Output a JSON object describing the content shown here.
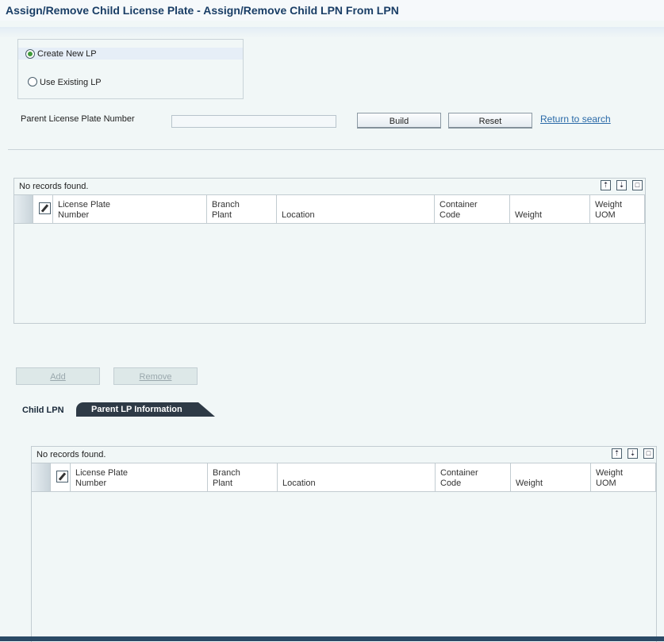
{
  "title": "Assign/Remove Child License Plate - Assign/Remove Child LPN From LPN",
  "options": {
    "create_new": "Create New LP",
    "use_existing": "Use Existing LP",
    "selected": "create_new"
  },
  "parent_lp": {
    "label": "Parent License Plate Number",
    "value": ""
  },
  "buttons": {
    "build": "Build",
    "reset": "Reset",
    "return": "Return to search",
    "add": "Add",
    "remove": "Remove"
  },
  "grid1": {
    "status": "No records found.",
    "columns": [
      {
        "l1": "License Plate",
        "l2": "Number"
      },
      {
        "l1": "Branch",
        "l2": "Plant"
      },
      {
        "l1": "",
        "l2": "Location"
      },
      {
        "l1": "Container",
        "l2": "Code"
      },
      {
        "l1": "",
        "l2": "Weight"
      },
      {
        "l1": "Weight",
        "l2": "UOM"
      }
    ]
  },
  "tabs": {
    "child": "Child LPN",
    "parent": "Parent LP Information"
  },
  "grid2": {
    "status": "No records found.",
    "columns": [
      {
        "l1": "License Plate",
        "l2": "Number"
      },
      {
        "l1": "Branch",
        "l2": "Plant"
      },
      {
        "l1": "",
        "l2": "Location"
      },
      {
        "l1": "Container",
        "l2": "Code"
      },
      {
        "l1": "",
        "l2": "Weight"
      },
      {
        "l1": "Weight",
        "l2": "UOM"
      }
    ]
  }
}
